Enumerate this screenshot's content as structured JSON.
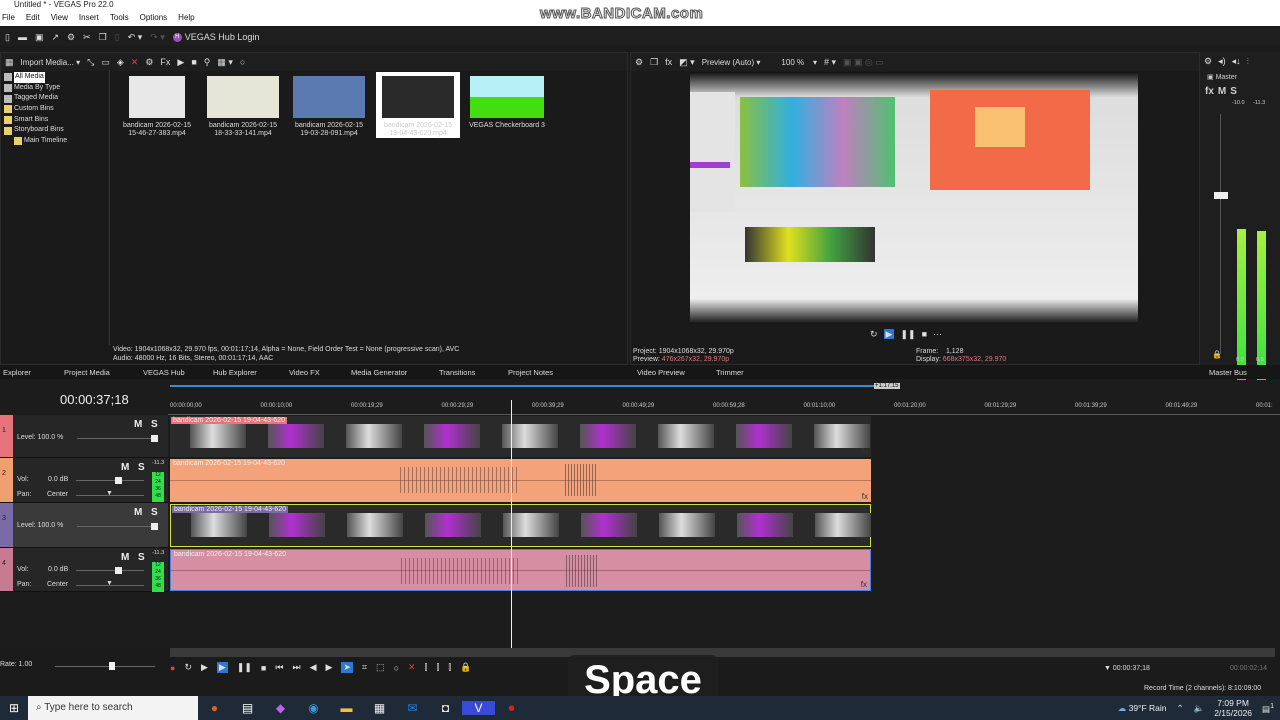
{
  "window": {
    "title": "Untitled * - VEGAS Pro 22.0"
  },
  "menu": [
    "File",
    "Edit",
    "View",
    "Insert",
    "Tools",
    "Options",
    "Help"
  ],
  "watermark": "www.BANDICAM.com",
  "toolbar": {
    "hub_login": "VEGAS Hub Login"
  },
  "media": {
    "import_label": "Import Media...",
    "tree": [
      "All Media",
      "Media By Type",
      "Tagged Media",
      "Custom Bins",
      "Smart Bins",
      "Storyboard Bins",
      "Main Timeline"
    ],
    "items": [
      {
        "line1": "bandicam 2026-02-15",
        "line2": "15-46-27-383.mp4",
        "color": "#e8e8e8"
      },
      {
        "line1": "bandicam 2026-02-15",
        "line2": "18-33-33-141.mp4",
        "color": "#e6e6d8"
      },
      {
        "line1": "bandicam 2026-02-15",
        "line2": "19-03-28-091.mp4",
        "color": "#5a7ab0"
      },
      {
        "line1": "bandicam 2026-02-15",
        "line2": "19-04-43-620.mp4",
        "color": "#2a2a2a"
      },
      {
        "line1": "VEGAS Checkerboard 3",
        "line2": "",
        "color": "#44dd10"
      }
    ],
    "info_video": "Video: 1904x1068x32, 29.970 fps, 00:01:17;14, Alpha = None, Field Order Test = None (progressive scan), AVC",
    "info_audio": "Audio: 48000 Hz, 16 Bits, Stereo, 00:01:17;14, AAC"
  },
  "preview": {
    "mode": "Preview (Auto)",
    "zoom": "100 %",
    "project_label": "Project:",
    "project": "1904x1068x32, 29.970p",
    "preview_label": "Preview:",
    "preview": "476x267x32, 29.970p",
    "frame_label": "Frame:",
    "frame": "1,128",
    "display_label": "Display:",
    "display": "668x375x32, 29.970"
  },
  "master": {
    "label": "Master",
    "fx": "fx",
    "m": "M",
    "s": "S",
    "peak_l": "-10.0",
    "peak_r": "-11.3",
    "bottom_l": "0.0",
    "bottom_r": "0.0",
    "level_l": 0.87,
    "level_r": 0.86
  },
  "tabs": [
    "Explorer",
    "Project Media",
    "VEGAS Hub",
    "Hub Explorer",
    "Video FX",
    "Media Generator",
    "Transitions",
    "Project Notes",
    "Video Preview",
    "Trimmer",
    "Master Bus"
  ],
  "timeline": {
    "timecode": "00:00:37;18",
    "loop_end": "+1:17;15",
    "ruler": [
      "00:00:00;00",
      "00:00:10;00",
      "00:00:19;29",
      "00:00:29;29",
      "00:00:39;29",
      "00:00:49;29",
      "00:00:59;28",
      "00:01:10;00",
      "00:01:20;00",
      "00:01:29;29",
      "00:01:39;29",
      "00:01:49;29",
      "00:01:"
    ],
    "tracks": [
      {
        "num": "1",
        "type": "video",
        "level_label": "Level:",
        "level": "100.0 %",
        "clip": "bandicam 2026-02-15 19-04-43-620",
        "color": "#e8737a",
        "clip_color": "#2a2a2a"
      },
      {
        "num": "2",
        "type": "audio",
        "vol_label": "Vol:",
        "vol": "0.0 dB",
        "pan_label": "Pan:",
        "pan": "Center",
        "peak": "-11.3",
        "clip": "bandicam 2026-02-15 19-04-43-620",
        "color": "#f0a070",
        "clip_color": "#f4a27a"
      },
      {
        "num": "3",
        "type": "video",
        "level_label": "Level:",
        "level": "100.0 %",
        "clip": "bandicam 2026-02-15 19-04-43-620",
        "color": "#7a6aa8",
        "clip_color": "#2a2a2a"
      },
      {
        "num": "4",
        "type": "audio",
        "vol_label": "Vol:",
        "vol": "0.0 dB",
        "pan_label": "Pan:",
        "pan": "Center",
        "peak": "-11.3",
        "clip": "bandicam 2026-02-15 19-04-43-620",
        "color": "#c87a90",
        "clip_color": "#d68ea2"
      }
    ],
    "m": "M",
    "s": "S",
    "vu_scale": [
      "12",
      "24",
      "36",
      "48"
    ]
  },
  "status": {
    "rate": "Rate: 1.00",
    "cursor_tc": "00:00:37;18",
    "sel_len": "00:00:02;14",
    "record_time": "Record Time (2 channels): 8:10:09:00"
  },
  "overlay_key": "Space",
  "taskbar": {
    "search_placeholder": "Type here to search",
    "weather": "39°F  Rain",
    "time": "7:09 PM",
    "date": "2/15/2026",
    "notif": "1"
  }
}
